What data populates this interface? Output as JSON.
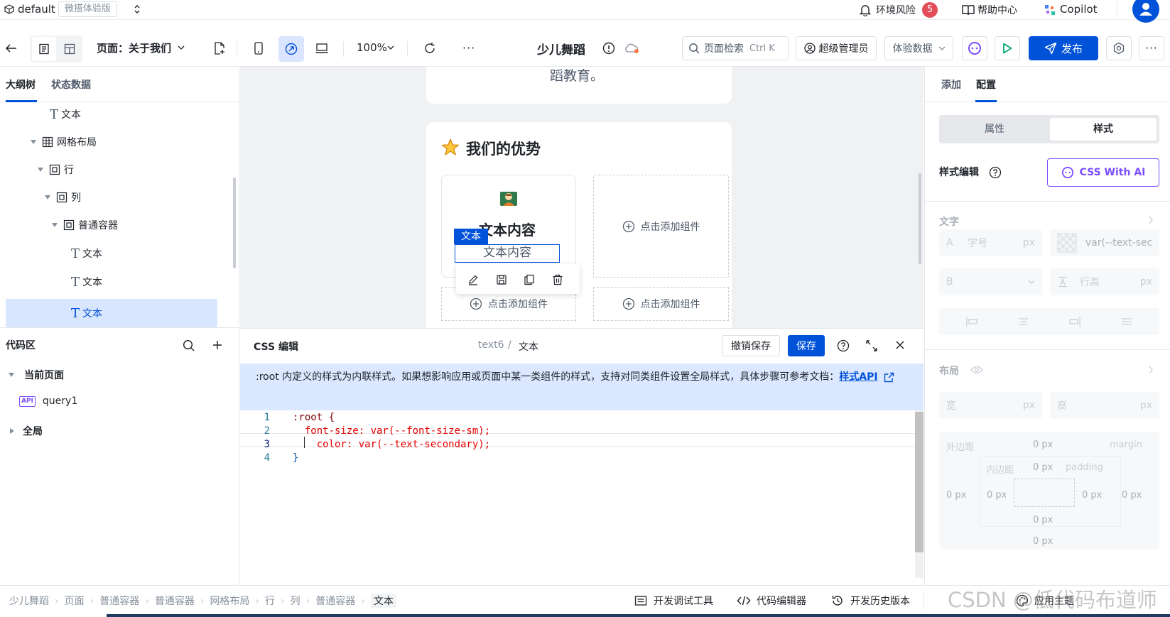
{
  "app": {
    "workspace": "default",
    "edition_badge": "微搭体验版",
    "env_risk_label": "环境风险",
    "env_risk_count": "5",
    "help_label": "帮助中心",
    "copilot_label": "Copilot"
  },
  "toolbar": {
    "page_label": "页面：关于我们",
    "zoom": "100%",
    "app_title": "少儿舞蹈",
    "search_placeholder": "页面检索",
    "search_shortcut": "Ctrl K",
    "role_label": "超级管理员",
    "data_label": "体验数据",
    "publish_label": "发布"
  },
  "left_panel": {
    "tabs": [
      "大纲树",
      "状态数据"
    ],
    "tree": [
      {
        "label": "文本",
        "icon": "text-icon"
      },
      {
        "label": "网格布局",
        "icon": "grid-icon"
      },
      {
        "label": "行",
        "icon": "box-icon"
      },
      {
        "label": "列",
        "icon": "box-icon"
      },
      {
        "label": "普通容器",
        "icon": "box-icon"
      },
      {
        "label": "文本",
        "icon": "text-icon"
      },
      {
        "label": "文本",
        "icon": "text-icon"
      },
      {
        "label": "文本",
        "icon": "text-icon"
      }
    ],
    "code_area_title": "代码区",
    "code_tree": {
      "current_page": "当前页面",
      "api_badge": "API",
      "query": "query1",
      "global": "全局"
    }
  },
  "canvas": {
    "top_text": "蹈教育。",
    "section_title": "我们的优势",
    "card_heading": "文本内容",
    "selected_tag": "文本",
    "selected_text": "文本内容",
    "add_component": "点击添加组件"
  },
  "right_panel": {
    "tabs": [
      "添加",
      "配置"
    ],
    "segments": [
      "属性",
      "样式"
    ],
    "style_edit_label": "样式编辑",
    "css_ai_label": "CSS With AI",
    "text_section": "文字",
    "font_size_placeholder": "字号",
    "unit_px": "px",
    "color_value": "var(--text-sec",
    "line_height_placeholder": "行高",
    "layout_section": "布局",
    "width_label": "宽",
    "height_label": "高",
    "margin_label": "外边距",
    "margin_en": "margin",
    "padding_label": "内边距",
    "padding_en": "padding",
    "zero_px": "0 px",
    "font_icon_a": "A",
    "font_icon_b": "B"
  },
  "css_editor": {
    "title": "CSS 编辑",
    "path_id": "text6",
    "path_sep": "/",
    "path_name": "文本",
    "undo_label": "撤销保存",
    "save_label": "保存",
    "notice": ":root 内定义的样式为内联样式。如果想影响应用或页面中某一类组件的样式，支持对同类组件设置全局样式，具体步骤可参考文档：",
    "notice_link": "样式API",
    "lines": [
      {
        "num": "1",
        "text": ":root {"
      },
      {
        "num": "2",
        "text": "  font-size: var(--font-size-sm);"
      },
      {
        "num": "3",
        "text": "    color: var(--text-secondary);"
      },
      {
        "num": "4",
        "text": "}"
      }
    ]
  },
  "footer": {
    "breadcrumb": [
      "少儿舞蹈",
      "页面",
      "普通容器",
      "普通容器",
      "网格布局",
      "行",
      "列",
      "普通容器",
      "文本"
    ],
    "devtools": "开发调试工具",
    "code_editor": "代码编辑器",
    "history": "开发历史版本",
    "theme": "应用主题"
  },
  "watermark": "CSDN @低代码布道师",
  "colors": {
    "primary": "#0052d9",
    "green": "#00a870",
    "danger": "#e34d59",
    "notice_bg": "#dbe8ff",
    "selected_bg": "#d9e6ff"
  }
}
